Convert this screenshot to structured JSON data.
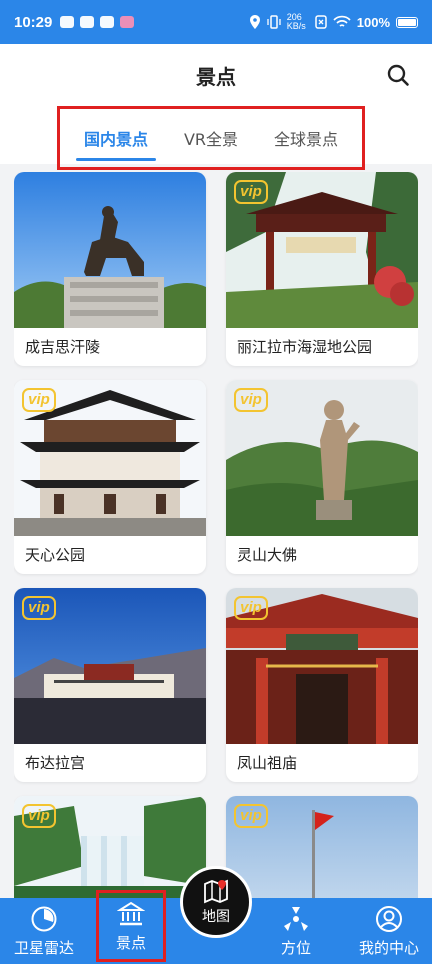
{
  "status": {
    "time": "10:29",
    "speed": "206 KB/s",
    "battery": "100%"
  },
  "header": {
    "title": "景点",
    "search_icon": "search-icon"
  },
  "tabs": [
    {
      "label": "国内景点",
      "active": true
    },
    {
      "label": "VR全景",
      "active": false
    },
    {
      "label": "全球景点",
      "active": false
    }
  ],
  "cards": [
    {
      "label": "成吉思汗陵",
      "vip": false
    },
    {
      "label": "丽江拉市海湿地公园",
      "vip": true
    },
    {
      "label": "天心公园",
      "vip": true
    },
    {
      "label": "灵山大佛",
      "vip": true
    },
    {
      "label": "布达拉宫",
      "vip": true
    },
    {
      "label": "凤山祖庙",
      "vip": true
    },
    {
      "label": "",
      "vip": true
    },
    {
      "label": "",
      "vip": true
    }
  ],
  "vip_badge": "vip",
  "bottom_nav": {
    "radar": "卫星雷达",
    "spots": "景点",
    "map": "地图",
    "direction": "方位",
    "mine": "我的中心"
  },
  "colors": {
    "brand_blue": "#2b86e8",
    "highlight_red": "#e02020",
    "vip_gold": "#f3c430"
  }
}
